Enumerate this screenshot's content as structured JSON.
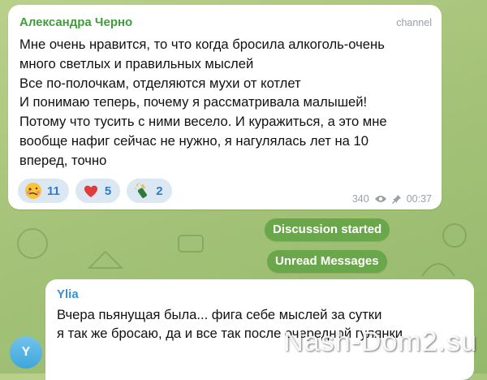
{
  "message1": {
    "sender": "Александра Черно",
    "tag": "channel",
    "text": "Мне очень нравится, то что когда бросила алкоголь-очень\nмного светлых и правильных мыслей\nВсе по-полочкам, отделяются мухи от котлет\nИ понимаю теперь, почему я рассматривала малышей!\nПотому что тусить с ними весело. И куражиться, а это мне\nвообще нафиг сейчас не нужно, я нагулялась лет на 10\nвперед, точно",
    "reactions": [
      {
        "icon": "woozy-face-icon",
        "count": "11"
      },
      {
        "icon": "red-heart-icon",
        "count": "5"
      },
      {
        "icon": "champagne-icon",
        "count": "2"
      }
    ],
    "views": "340",
    "time": "00:37"
  },
  "service": {
    "discussion": "Discussion started",
    "unread": "Unread Messages"
  },
  "message2": {
    "avatar_letter": "Y",
    "sender": "Ylia",
    "text": "Вчера пьянущая была... фига себе мыслей за сутки\nя так же бросаю, да и все так после очередной гулянки"
  },
  "watermark": "Nash-Dom2.su",
  "colors": {
    "sender1": "#3f9e3a",
    "sender2": "#3a92d4",
    "service_pill": "#6aa74a",
    "reaction_bg": "#dbe8f4"
  }
}
